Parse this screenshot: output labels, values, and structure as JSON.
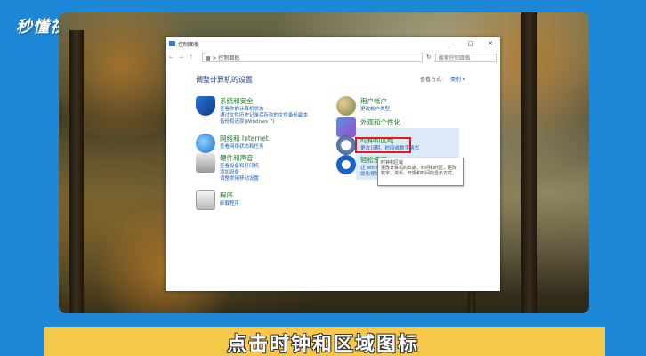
{
  "brand": {
    "logo_text": "秒懂视频"
  },
  "subtitle": "点击时钟和区域图标",
  "window": {
    "title": "控制面板",
    "controls": {
      "minimize": "—",
      "maximize": "□",
      "close": "✕"
    },
    "address": {
      "nav": "← → ↑",
      "path": "▦ > 控制面板",
      "refresh": "↻",
      "search_placeholder": "搜索控制面板"
    },
    "heading": "调整计算机的设置",
    "view_by": {
      "label": "查看方式:",
      "value": "类别 ▾"
    }
  },
  "categories_left": [
    {
      "title": "系统和安全",
      "links": [
        "查看你的计算机状态",
        "通过文件历史记录保存你的文件备份副本",
        "备份和还原(Windows 7)"
      ]
    },
    {
      "title": "网络和 Internet",
      "links": [
        "查看网络状态和任务"
      ]
    },
    {
      "title": "硬件和声音",
      "links": [
        "查看设备和打印机",
        "添加设备",
        "调整常用移动设置"
      ]
    },
    {
      "title": "程序",
      "links": [
        "卸载程序"
      ]
    }
  ],
  "categories_right": [
    {
      "title": "用户帐户",
      "links": [
        "更改帐户类型"
      ]
    },
    {
      "title": "外观和个性化",
      "links": []
    },
    {
      "title": "时钟和区域",
      "links": [
        "更改日期、时间或数字格式"
      ]
    },
    {
      "title": "轻松使用",
      "links": [
        "让 Windows 建议设置",
        "优化视觉显示"
      ]
    }
  ],
  "tooltip": "时钟和区域\n更改计算机的日期、时间和时区，更改数字、货币、日期和时间的显示方式。",
  "colors": {
    "frame": "#1e88d8",
    "subtitle_bar": "#f6c84a",
    "highlight_box": "#e21a1a",
    "link": "#1a5fb4",
    "category_title": "#1f7a2a"
  }
}
